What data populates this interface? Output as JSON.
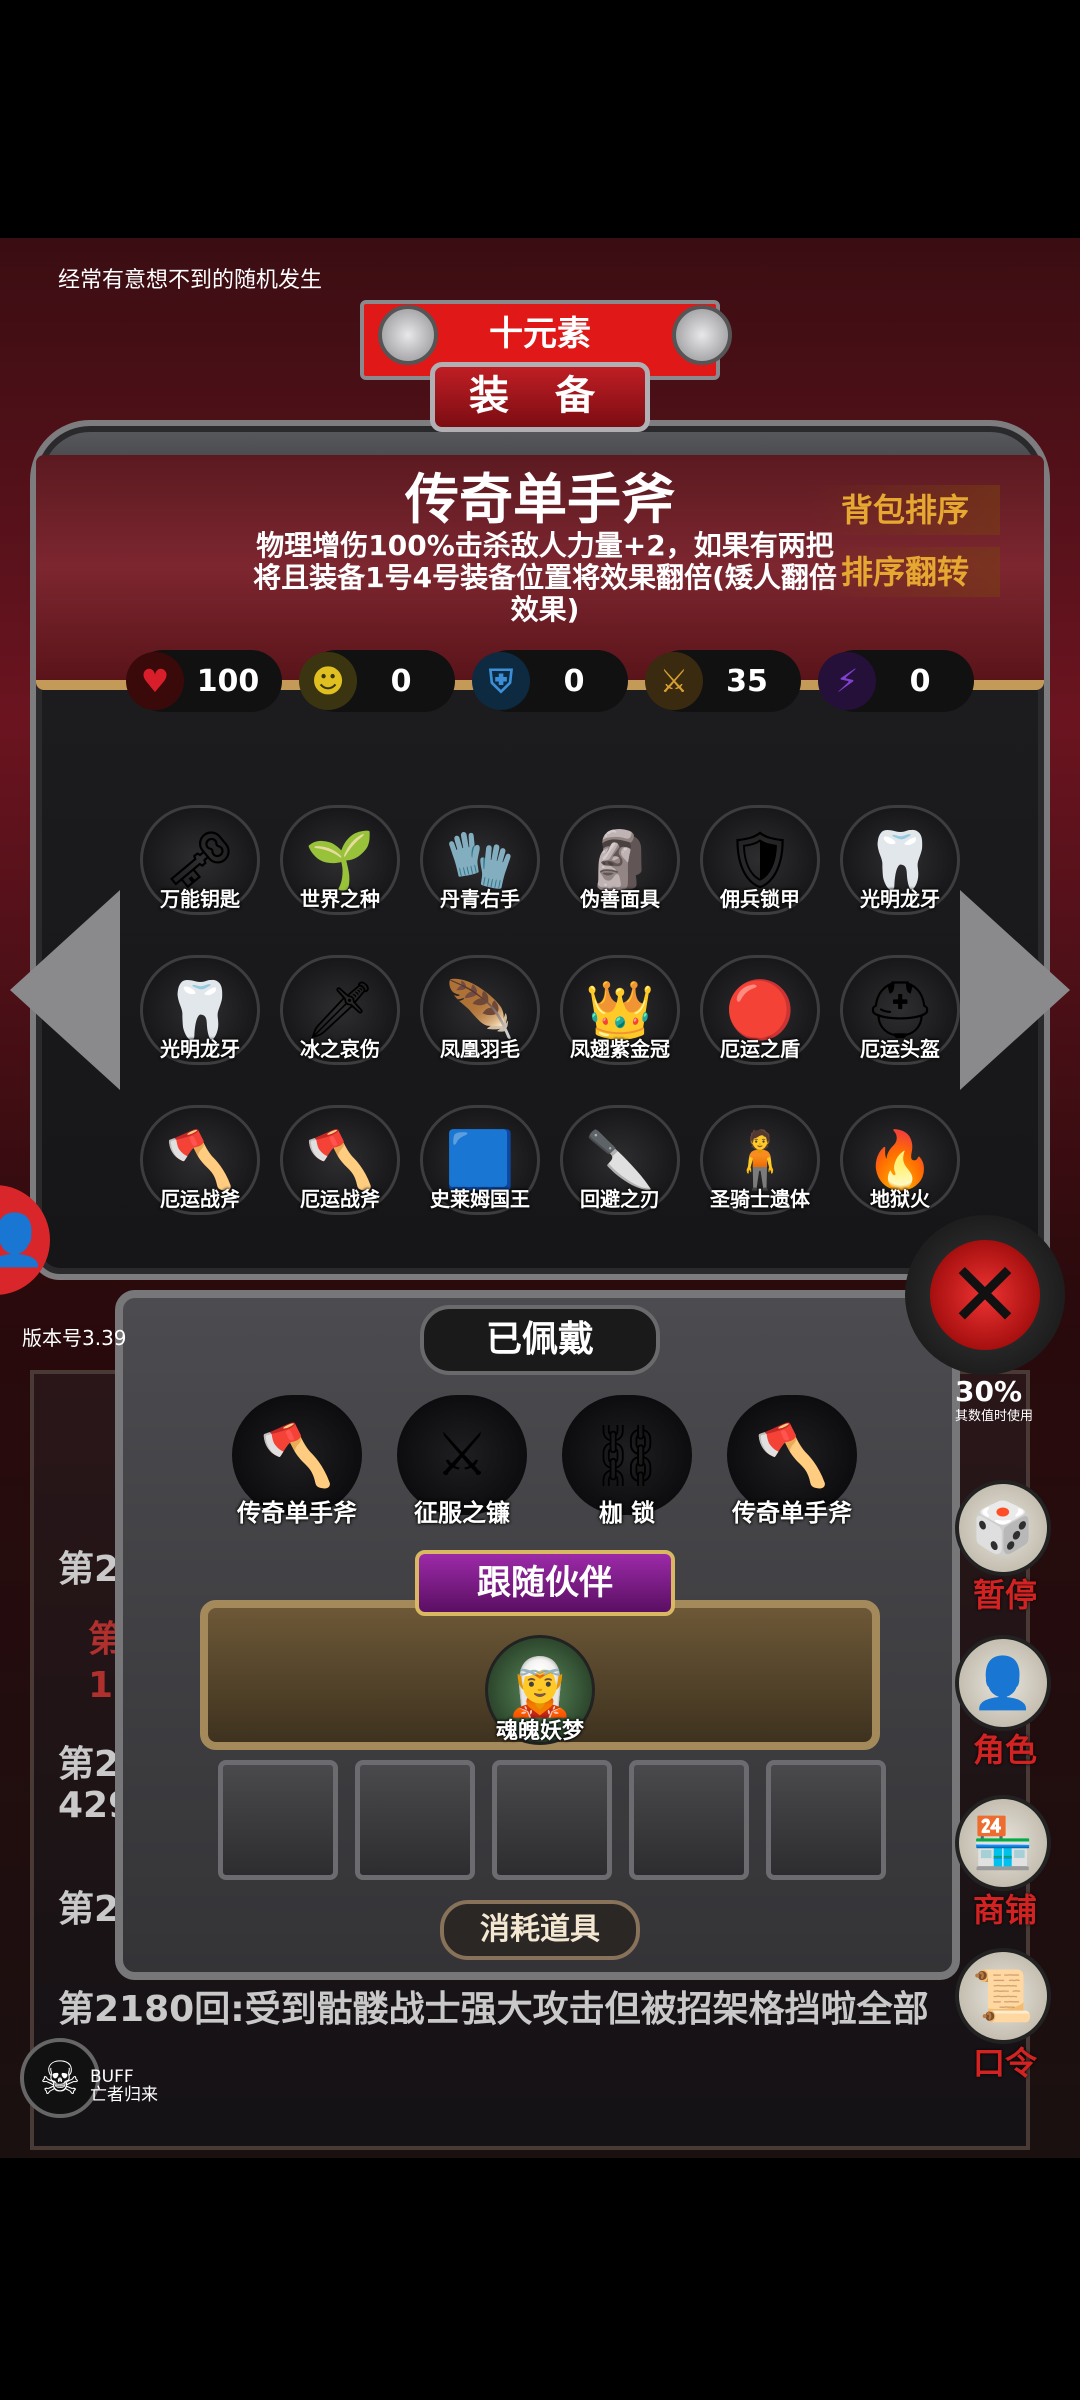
{
  "tip_text": "经常有意想不到的随机发生",
  "element_badge": "十元素",
  "panel_banner": "装 备",
  "item": {
    "name": "传奇单手斧",
    "description": "物理增伤100%击杀敌人力量+2，如果有两把将且装备1号4号装备位置将效果翻倍(矮人翻倍效果)"
  },
  "buttons": {
    "sort_bag": "背包排序",
    "sort_reverse": "排序翻转"
  },
  "stats": [
    {
      "icon": "heart-icon",
      "value": "100",
      "color": "#d81e2a"
    },
    {
      "icon": "strength-icon",
      "value": "0",
      "color": "#e0c020"
    },
    {
      "icon": "armor-icon",
      "value": "0",
      "color": "#3a8fd8"
    },
    {
      "icon": "sword-icon",
      "value": "35",
      "color": "#d8a030"
    },
    {
      "icon": "lightning-icon",
      "value": "0",
      "color": "#8040d0"
    }
  ],
  "items": [
    {
      "label": "万能钥匙",
      "glyph": "🗝"
    },
    {
      "label": "世界之种",
      "glyph": "🌱"
    },
    {
      "label": "丹青右手",
      "glyph": "🧤"
    },
    {
      "label": "伪善面具",
      "glyph": "🗿"
    },
    {
      "label": "佣兵锁甲",
      "glyph": "🛡"
    },
    {
      "label": "光明龙牙",
      "glyph": "🦷"
    },
    {
      "label": "光明龙牙",
      "glyph": "🦷"
    },
    {
      "label": "冰之哀伤",
      "glyph": "🗡"
    },
    {
      "label": "凤凰羽毛",
      "glyph": "🪶"
    },
    {
      "label": "凤翅紫金冠",
      "glyph": "👑"
    },
    {
      "label": "厄运之盾",
      "glyph": "🔴"
    },
    {
      "label": "厄运头盔",
      "glyph": "⛑"
    },
    {
      "label": "厄运战斧",
      "glyph": "🪓"
    },
    {
      "label": "厄运战斧",
      "glyph": "🪓"
    },
    {
      "label": "史莱姆国王",
      "glyph": "🟦"
    },
    {
      "label": "回避之刃",
      "glyph": "🔪"
    },
    {
      "label": "圣骑士遗体",
      "glyph": "🧍"
    },
    {
      "label": "地狱火",
      "glyph": "🔥"
    }
  ],
  "worn_title": "已佩戴",
  "worn": [
    {
      "label": "传奇单手斧",
      "glyph": "🪓"
    },
    {
      "label": "征服之镰",
      "glyph": "⚔"
    },
    {
      "label": "枷 锁",
      "glyph": "⛓"
    },
    {
      "label": "传奇单手斧",
      "glyph": "🪓"
    }
  ],
  "companion_title": "跟随伙伴",
  "companion_name": "魂魄妖梦",
  "consumables_title": "消耗道具",
  "version": "版本号3.39",
  "percent": "30%",
  "percent_sub": "其数值时使用",
  "side_menu": [
    {
      "label": "暂停",
      "glyph": "🎲"
    },
    {
      "label": "角色",
      "glyph": "👤"
    },
    {
      "label": "商铺",
      "glyph": "🏪"
    },
    {
      "label": "口令",
      "glyph": "📜"
    }
  ],
  "logs": {
    "l1": "第2",
    "l2": "第",
    "l3": "1",
    "l4": "第21",
    "l5": "4293",
    "l6": "第2",
    "l7": "第2180回:受到骷髅战士强大攻击但被招架格挡啦全部",
    "l8": "空"
  },
  "buff": {
    "label": "BUFF",
    "sub": "亡者归来"
  }
}
